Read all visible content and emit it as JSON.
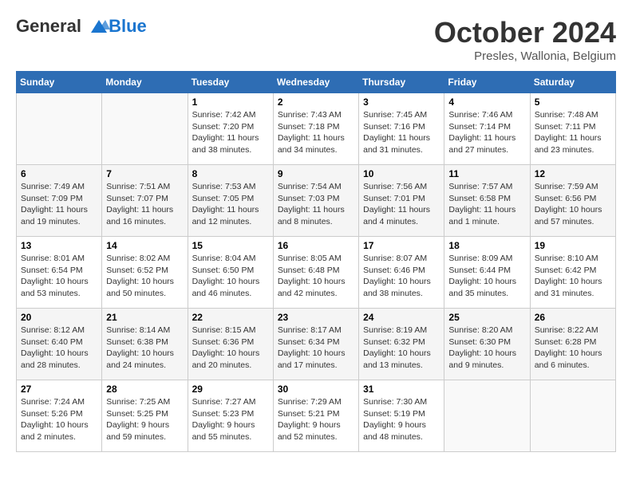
{
  "header": {
    "logo_line1": "General",
    "logo_line2": "Blue",
    "month": "October 2024",
    "location": "Presles, Wallonia, Belgium"
  },
  "days_of_week": [
    "Sunday",
    "Monday",
    "Tuesday",
    "Wednesday",
    "Thursday",
    "Friday",
    "Saturday"
  ],
  "weeks": [
    [
      {
        "day": "",
        "sunrise": "",
        "sunset": "",
        "daylight": ""
      },
      {
        "day": "",
        "sunrise": "",
        "sunset": "",
        "daylight": ""
      },
      {
        "day": "1",
        "sunrise": "Sunrise: 7:42 AM",
        "sunset": "Sunset: 7:20 PM",
        "daylight": "Daylight: 11 hours and 38 minutes."
      },
      {
        "day": "2",
        "sunrise": "Sunrise: 7:43 AM",
        "sunset": "Sunset: 7:18 PM",
        "daylight": "Daylight: 11 hours and 34 minutes."
      },
      {
        "day": "3",
        "sunrise": "Sunrise: 7:45 AM",
        "sunset": "Sunset: 7:16 PM",
        "daylight": "Daylight: 11 hours and 31 minutes."
      },
      {
        "day": "4",
        "sunrise": "Sunrise: 7:46 AM",
        "sunset": "Sunset: 7:14 PM",
        "daylight": "Daylight: 11 hours and 27 minutes."
      },
      {
        "day": "5",
        "sunrise": "Sunrise: 7:48 AM",
        "sunset": "Sunset: 7:11 PM",
        "daylight": "Daylight: 11 hours and 23 minutes."
      }
    ],
    [
      {
        "day": "6",
        "sunrise": "Sunrise: 7:49 AM",
        "sunset": "Sunset: 7:09 PM",
        "daylight": "Daylight: 11 hours and 19 minutes."
      },
      {
        "day": "7",
        "sunrise": "Sunrise: 7:51 AM",
        "sunset": "Sunset: 7:07 PM",
        "daylight": "Daylight: 11 hours and 16 minutes."
      },
      {
        "day": "8",
        "sunrise": "Sunrise: 7:53 AM",
        "sunset": "Sunset: 7:05 PM",
        "daylight": "Daylight: 11 hours and 12 minutes."
      },
      {
        "day": "9",
        "sunrise": "Sunrise: 7:54 AM",
        "sunset": "Sunset: 7:03 PM",
        "daylight": "Daylight: 11 hours and 8 minutes."
      },
      {
        "day": "10",
        "sunrise": "Sunrise: 7:56 AM",
        "sunset": "Sunset: 7:01 PM",
        "daylight": "Daylight: 11 hours and 4 minutes."
      },
      {
        "day": "11",
        "sunrise": "Sunrise: 7:57 AM",
        "sunset": "Sunset: 6:58 PM",
        "daylight": "Daylight: 11 hours and 1 minute."
      },
      {
        "day": "12",
        "sunrise": "Sunrise: 7:59 AM",
        "sunset": "Sunset: 6:56 PM",
        "daylight": "Daylight: 10 hours and 57 minutes."
      }
    ],
    [
      {
        "day": "13",
        "sunrise": "Sunrise: 8:01 AM",
        "sunset": "Sunset: 6:54 PM",
        "daylight": "Daylight: 10 hours and 53 minutes."
      },
      {
        "day": "14",
        "sunrise": "Sunrise: 8:02 AM",
        "sunset": "Sunset: 6:52 PM",
        "daylight": "Daylight: 10 hours and 50 minutes."
      },
      {
        "day": "15",
        "sunrise": "Sunrise: 8:04 AM",
        "sunset": "Sunset: 6:50 PM",
        "daylight": "Daylight: 10 hours and 46 minutes."
      },
      {
        "day": "16",
        "sunrise": "Sunrise: 8:05 AM",
        "sunset": "Sunset: 6:48 PM",
        "daylight": "Daylight: 10 hours and 42 minutes."
      },
      {
        "day": "17",
        "sunrise": "Sunrise: 8:07 AM",
        "sunset": "Sunset: 6:46 PM",
        "daylight": "Daylight: 10 hours and 38 minutes."
      },
      {
        "day": "18",
        "sunrise": "Sunrise: 8:09 AM",
        "sunset": "Sunset: 6:44 PM",
        "daylight": "Daylight: 10 hours and 35 minutes."
      },
      {
        "day": "19",
        "sunrise": "Sunrise: 8:10 AM",
        "sunset": "Sunset: 6:42 PM",
        "daylight": "Daylight: 10 hours and 31 minutes."
      }
    ],
    [
      {
        "day": "20",
        "sunrise": "Sunrise: 8:12 AM",
        "sunset": "Sunset: 6:40 PM",
        "daylight": "Daylight: 10 hours and 28 minutes."
      },
      {
        "day": "21",
        "sunrise": "Sunrise: 8:14 AM",
        "sunset": "Sunset: 6:38 PM",
        "daylight": "Daylight: 10 hours and 24 minutes."
      },
      {
        "day": "22",
        "sunrise": "Sunrise: 8:15 AM",
        "sunset": "Sunset: 6:36 PM",
        "daylight": "Daylight: 10 hours and 20 minutes."
      },
      {
        "day": "23",
        "sunrise": "Sunrise: 8:17 AM",
        "sunset": "Sunset: 6:34 PM",
        "daylight": "Daylight: 10 hours and 17 minutes."
      },
      {
        "day": "24",
        "sunrise": "Sunrise: 8:19 AM",
        "sunset": "Sunset: 6:32 PM",
        "daylight": "Daylight: 10 hours and 13 minutes."
      },
      {
        "day": "25",
        "sunrise": "Sunrise: 8:20 AM",
        "sunset": "Sunset: 6:30 PM",
        "daylight": "Daylight: 10 hours and 9 minutes."
      },
      {
        "day": "26",
        "sunrise": "Sunrise: 8:22 AM",
        "sunset": "Sunset: 6:28 PM",
        "daylight": "Daylight: 10 hours and 6 minutes."
      }
    ],
    [
      {
        "day": "27",
        "sunrise": "Sunrise: 7:24 AM",
        "sunset": "Sunset: 5:26 PM",
        "daylight": "Daylight: 10 hours and 2 minutes."
      },
      {
        "day": "28",
        "sunrise": "Sunrise: 7:25 AM",
        "sunset": "Sunset: 5:25 PM",
        "daylight": "Daylight: 9 hours and 59 minutes."
      },
      {
        "day": "29",
        "sunrise": "Sunrise: 7:27 AM",
        "sunset": "Sunset: 5:23 PM",
        "daylight": "Daylight: 9 hours and 55 minutes."
      },
      {
        "day": "30",
        "sunrise": "Sunrise: 7:29 AM",
        "sunset": "Sunset: 5:21 PM",
        "daylight": "Daylight: 9 hours and 52 minutes."
      },
      {
        "day": "31",
        "sunrise": "Sunrise: 7:30 AM",
        "sunset": "Sunset: 5:19 PM",
        "daylight": "Daylight: 9 hours and 48 minutes."
      },
      {
        "day": "",
        "sunrise": "",
        "sunset": "",
        "daylight": ""
      },
      {
        "day": "",
        "sunrise": "",
        "sunset": "",
        "daylight": ""
      }
    ]
  ]
}
